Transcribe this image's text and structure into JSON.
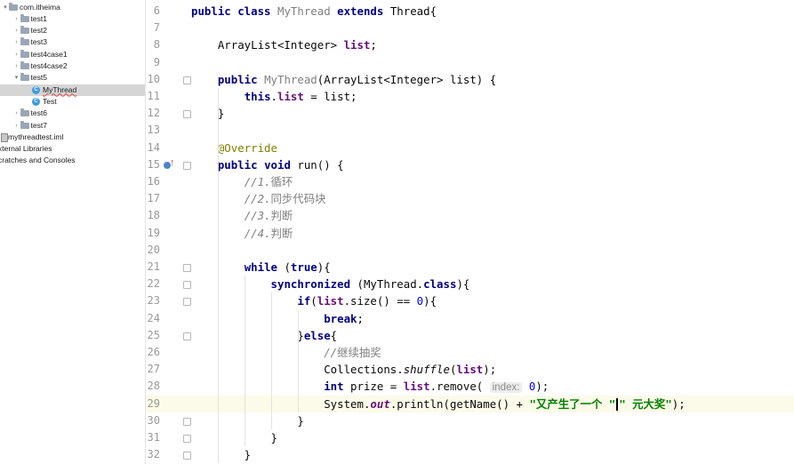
{
  "project_tree": {
    "items": [
      {
        "label": "com.itheima",
        "kind": "package",
        "indent": 0,
        "expanded": true,
        "selected": false
      },
      {
        "label": "test1",
        "kind": "package",
        "indent": 1,
        "expanded": false,
        "selected": false
      },
      {
        "label": "test2",
        "kind": "package",
        "indent": 1,
        "expanded": false,
        "selected": false
      },
      {
        "label": "test3",
        "kind": "package",
        "indent": 1,
        "expanded": false,
        "selected": false
      },
      {
        "label": "test4case1",
        "kind": "package",
        "indent": 1,
        "expanded": false,
        "selected": false
      },
      {
        "label": "test4case2",
        "kind": "package",
        "indent": 1,
        "expanded": false,
        "selected": false
      },
      {
        "label": "test5",
        "kind": "package",
        "indent": 1,
        "expanded": true,
        "selected": false
      },
      {
        "label": "MyThread",
        "kind": "class",
        "indent": 2,
        "expanded": false,
        "selected": true
      },
      {
        "label": "Test",
        "kind": "class",
        "indent": 2,
        "expanded": false,
        "selected": false
      },
      {
        "label": "test6",
        "kind": "package",
        "indent": 1,
        "expanded": false,
        "selected": false
      },
      {
        "label": "test7",
        "kind": "package",
        "indent": 1,
        "expanded": false,
        "selected": false
      },
      {
        "label": "mythreadtest.iml",
        "kind": "file",
        "indent": 0,
        "expanded": false,
        "selected": false
      },
      {
        "label": "xternal Libraries",
        "kind": "plain",
        "indent": 0,
        "expanded": false,
        "selected": false
      },
      {
        "label": "cratches and Consoles",
        "kind": "plain",
        "indent": 0,
        "expanded": false,
        "selected": false
      }
    ]
  },
  "editor": {
    "current_line": 29,
    "lines": [
      {
        "no": "6",
        "tokens": [
          [
            "kw",
            "public "
          ],
          [
            "kw",
            "class "
          ],
          [
            "cls",
            "MyThread "
          ],
          [
            "kw",
            "extends "
          ],
          [
            "ty",
            "Thread{"
          ]
        ]
      },
      {
        "no": "7",
        "tokens": []
      },
      {
        "no": "8",
        "tokens": [
          [
            "ty",
            "    ArrayList<Integer> "
          ],
          [
            "fld",
            "list"
          ],
          [
            "ty",
            ";"
          ]
        ]
      },
      {
        "no": "9",
        "tokens": []
      },
      {
        "no": "10",
        "tokens": [
          [
            "ty",
            "    "
          ],
          [
            "kw",
            "public "
          ],
          [
            "cls",
            "MyThread"
          ],
          [
            "ty",
            "(ArrayList<Integer> list) {"
          ]
        ]
      },
      {
        "no": "11",
        "tokens": [
          [
            "ty",
            "        "
          ],
          [
            "kw",
            "this"
          ],
          [
            "ty",
            "."
          ],
          [
            "fld",
            "list"
          ],
          [
            "ty",
            " = list;"
          ]
        ]
      },
      {
        "no": "12",
        "tokens": [
          [
            "ty",
            "    }"
          ]
        ]
      },
      {
        "no": "13",
        "tokens": []
      },
      {
        "no": "14",
        "tokens": [
          [
            "ty",
            "    "
          ],
          [
            "ann",
            "@Override"
          ]
        ]
      },
      {
        "no": "15",
        "tokens": [
          [
            "ty",
            "    "
          ],
          [
            "kw",
            "public "
          ],
          [
            "kw",
            "void "
          ],
          [
            "ty",
            "run() {"
          ]
        ]
      },
      {
        "no": "16",
        "tokens": [
          [
            "ty",
            "        "
          ],
          [
            "cmt",
            "//1."
          ],
          [
            "cmtz",
            "循环"
          ]
        ]
      },
      {
        "no": "17",
        "tokens": [
          [
            "ty",
            "        "
          ],
          [
            "cmt",
            "//2."
          ],
          [
            "cmtz",
            "同步代码块"
          ]
        ]
      },
      {
        "no": "18",
        "tokens": [
          [
            "ty",
            "        "
          ],
          [
            "cmt",
            "//3."
          ],
          [
            "cmtz",
            "判断"
          ]
        ]
      },
      {
        "no": "19",
        "tokens": [
          [
            "ty",
            "        "
          ],
          [
            "cmt",
            "//4."
          ],
          [
            "cmtz",
            "判断"
          ]
        ]
      },
      {
        "no": "20",
        "tokens": []
      },
      {
        "no": "21",
        "tokens": [
          [
            "ty",
            "        "
          ],
          [
            "kw",
            "while "
          ],
          [
            "ty",
            "("
          ],
          [
            "kw",
            "true"
          ],
          [
            "ty",
            "){"
          ]
        ]
      },
      {
        "no": "22",
        "tokens": [
          [
            "ty",
            "            "
          ],
          [
            "kw",
            "synchronized "
          ],
          [
            "ty",
            "(MyThread."
          ],
          [
            "kw",
            "class"
          ],
          [
            "ty",
            "){"
          ]
        ]
      },
      {
        "no": "23",
        "tokens": [
          [
            "ty",
            "                "
          ],
          [
            "kw",
            "if"
          ],
          [
            "ty",
            "("
          ],
          [
            "fld",
            "list"
          ],
          [
            "ty",
            ".size() == "
          ],
          [
            "num",
            "0"
          ],
          [
            "ty",
            "){"
          ]
        ]
      },
      {
        "no": "24",
        "tokens": [
          [
            "ty",
            "                    "
          ],
          [
            "kw",
            "break"
          ],
          [
            "ty",
            ";"
          ]
        ]
      },
      {
        "no": "25",
        "tokens": [
          [
            "ty",
            "                }"
          ],
          [
            "kw",
            "else"
          ],
          [
            "ty",
            "{"
          ]
        ]
      },
      {
        "no": "26",
        "tokens": [
          [
            "ty",
            "                    "
          ],
          [
            "cmt",
            "//"
          ],
          [
            "cmtz",
            "继续抽奖"
          ]
        ]
      },
      {
        "no": "27",
        "tokens": [
          [
            "ty",
            "                    Collections."
          ],
          [
            "it",
            "shuffle"
          ],
          [
            "ty",
            "("
          ],
          [
            "fld",
            "list"
          ],
          [
            "ty",
            ");"
          ]
        ]
      },
      {
        "no": "28",
        "tokens": [
          [
            "ty",
            "                    "
          ],
          [
            "kw",
            "int "
          ],
          [
            "ty",
            "prize = "
          ],
          [
            "fld",
            "list"
          ],
          [
            "ty",
            ".remove( "
          ],
          [
            "hint",
            "index:"
          ],
          [
            "ty",
            " "
          ],
          [
            "num",
            "0"
          ],
          [
            "ty",
            ");"
          ]
        ]
      },
      {
        "no": "29",
        "tokens": [
          [
            "ty",
            "                    System."
          ],
          [
            "itf",
            "out"
          ],
          [
            "ty",
            ".println(getName() + "
          ],
          [
            "str",
            "\"又产生了一个 \""
          ],
          [
            "cursor",
            ""
          ],
          [
            "str",
            "\" 元大奖\""
          ],
          [
            "ty",
            ");"
          ]
        ]
      },
      {
        "no": "30",
        "tokens": [
          [
            "ty",
            "                }"
          ]
        ]
      },
      {
        "no": "31",
        "tokens": [
          [
            "ty",
            "            }"
          ]
        ]
      },
      {
        "no": "32",
        "tokens": [
          [
            "ty",
            "        }"
          ]
        ]
      }
    ]
  },
  "colors": {
    "keyword": "#000080",
    "field": "#660e7a",
    "comment": "#808080",
    "annotation": "#808000",
    "number": "#0000ff",
    "string": "#008000",
    "current_line_bg": "#fcfae8"
  }
}
